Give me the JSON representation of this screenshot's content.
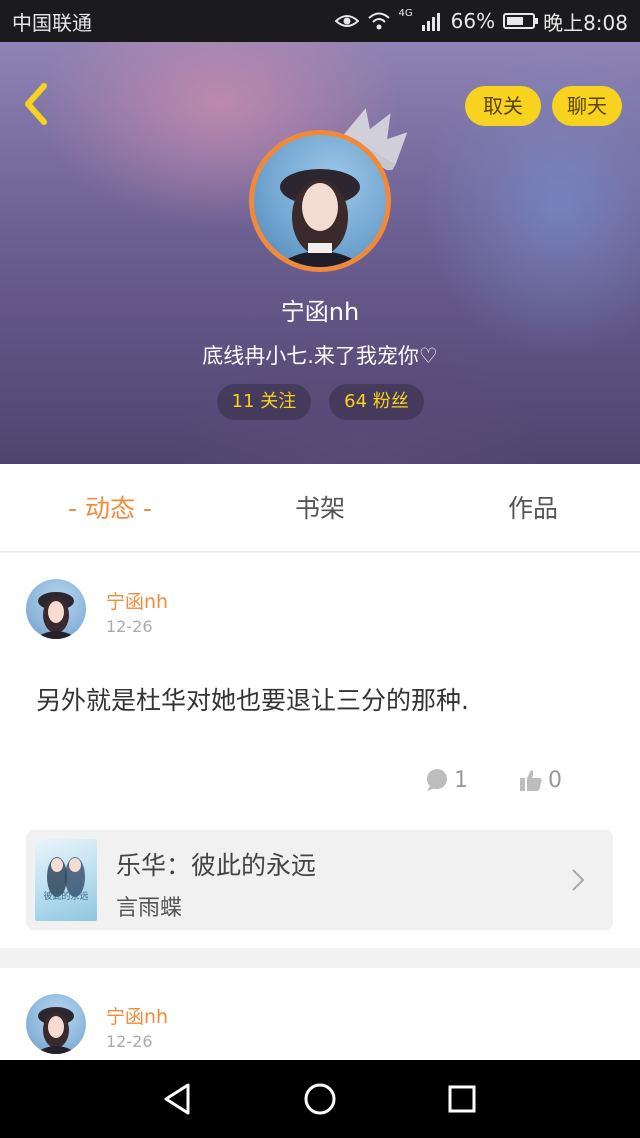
{
  "status_bar": {
    "carrier": "中国联通",
    "network": "4G",
    "battery_percent": "66%",
    "battery_level": 0.66,
    "time": "晚上8:08"
  },
  "header": {
    "back_icon": "chevron-left-icon",
    "unfollow_label": "取关",
    "chat_label": "聊天",
    "username": "宁函nh",
    "bio": "底线冉小七.来了我宠你♡",
    "following": "11 关注",
    "fans": "64 粉丝",
    "accent_color": "#f7d21e"
  },
  "tabs": {
    "dynamic": "- 动态 -",
    "shelf": "书架",
    "works": "作品",
    "active_color": "#f28b3b"
  },
  "posts": [
    {
      "author": "宁函nh",
      "date": "12-26",
      "text": "另外就是杜华对她也要退让三分的那种.",
      "comments": "1",
      "likes": "0",
      "book": {
        "title": "乐华：彼此的永远",
        "author": "言雨蝶",
        "cover_text": "彼此的永远"
      }
    },
    {
      "author": "宁函nh",
      "date": "12-26"
    }
  ],
  "nav": {
    "back": "back-triangle-icon",
    "home": "home-circle-icon",
    "recents": "recents-square-icon"
  }
}
